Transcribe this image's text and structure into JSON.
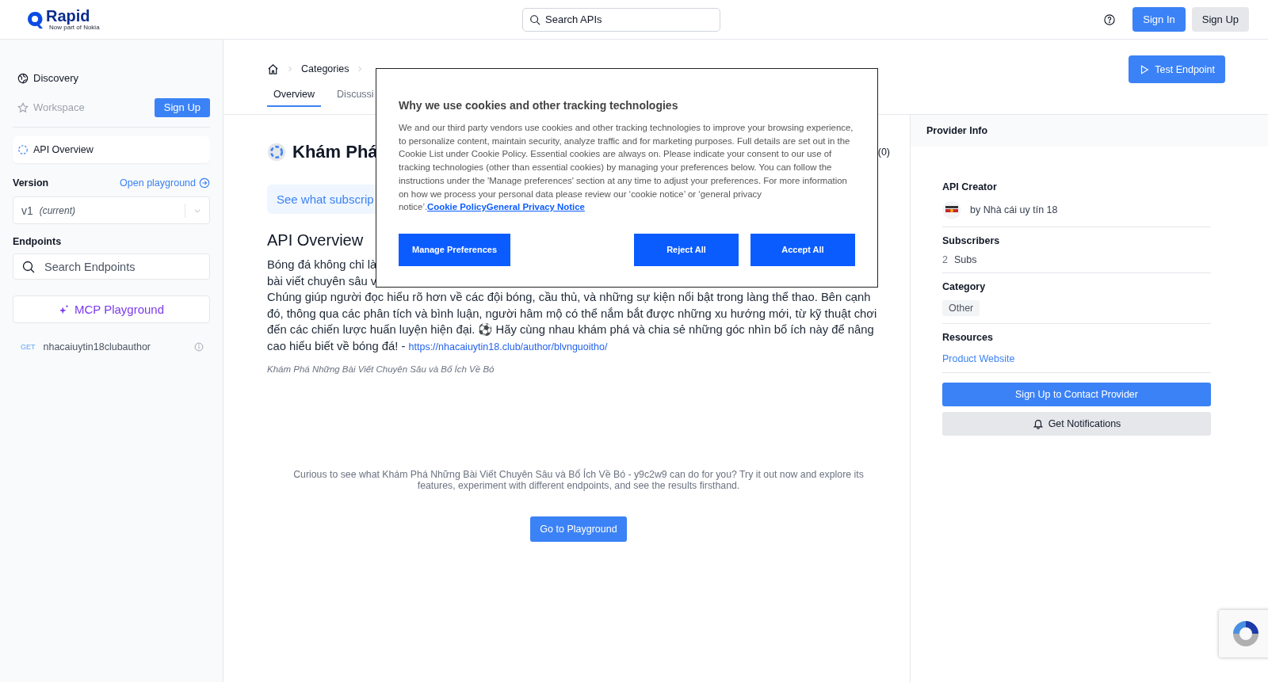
{
  "header": {
    "logo": "Rapid",
    "tagline": "Now part of Nokia",
    "search": {
      "placeholder": "Search APIs"
    },
    "sign_in": "Sign In",
    "sign_up": "Sign Up"
  },
  "sidebar": {
    "nav": [
      {
        "label": "Discovery",
        "disabled": false
      },
      {
        "label": "Workspace",
        "disabled": true
      }
    ],
    "sign_up": "Sign Up",
    "overview": {
      "label": "API Overview",
      "selected": true
    },
    "version_label": "Version",
    "open_playground": "Open playground",
    "version": {
      "value": "v1",
      "note": "(current)"
    },
    "endpoints_label": "Endpoints",
    "endpoint_search": {
      "placeholder": "Search Endpoints"
    },
    "mcp": "MCP Playground",
    "endpoints": [
      {
        "method": "GET",
        "name": "nhacaiuytin18clubauthor"
      }
    ]
  },
  "breadcrumb": [
    "Categories"
  ],
  "tabs": [
    {
      "label": "Overview",
      "selected": true
    },
    {
      "label": "Discussi",
      "selected": false
    }
  ],
  "test_endpoint": "Test Endpoint",
  "title": "Khám Phá",
  "rating": "(0)",
  "banner": "See what subscrip",
  "overview": {
    "heading": "API Overview",
    "fragments": [
      "Bóng đá không chỉ là",
      "bài viết chuyên sâu v"
    ],
    "text": "Chúng giúp người đọc hiểu rõ hơn về các đội bóng, cầu thủ, và những sự kiện nổi bật trong làng thể thao. Bên cạnh đó, thông qua các phân tích và bình luận, người hâm mộ có thể nắm bắt được những xu hướng mới, từ kỹ thuật chơi đến các chiến lược huấn luyện hiện đại. ⚽ Hãy cùng nhau khám phá và chia sẻ những góc nhìn bổ ích này để nâng cao hiểu biết về bóng đá! -",
    "link": "https://nhacaiuytin18.club/author/blvnguoitho/",
    "caption": "Khám Phá Những Bài Viết Chuyên Sâu và Bổ Ích Về Bó"
  },
  "cta": {
    "text": "Curious to see what Khám Phá Những Bài Viết Chuyên Sâu và Bổ Ích Về Bó - y9c2w9 can do for you? Try it out now and explore its features, experiment with different endpoints, and see the results firsthand.",
    "button": "Go to Playground"
  },
  "provider": {
    "heading": "Provider Info",
    "creator_label": "API Creator",
    "creator": "by Nhà cái uy tín 18",
    "subscribers_label": "Subscribers",
    "subscribers": "2",
    "subs_unit": "Subs",
    "category_label": "Category",
    "category": "Other",
    "resources_label": "Resources",
    "resource_link": "Product Website",
    "contact": "Sign Up to Contact Provider",
    "notify": "Get Notifications"
  },
  "cookie_dialog": {
    "title": "Why we use cookies and other tracking technologies",
    "body": "We and our third party vendors use cookies and other tracking technologies to improve your browsing experience, to personalize content, maintain security, analyze traffic and for marketing purposes. Full details are set out in the Cookie List under Cookie Policy. Essential cookies are always on. Please indicate your consent to our use of tracking technologies (other than essential cookies) by managing your preferences below. You can follow the instructions under the 'Manage preferences' section at any time to adjust your preferences. For more information on how we process your personal data please review our ‘cookie notice’ or ‘general privacy notice’.",
    "links": [
      "Cookie Policy",
      "General Privacy Notice"
    ],
    "manage": "Manage Preferences",
    "reject": "Reject All",
    "accept": "Accept All"
  }
}
